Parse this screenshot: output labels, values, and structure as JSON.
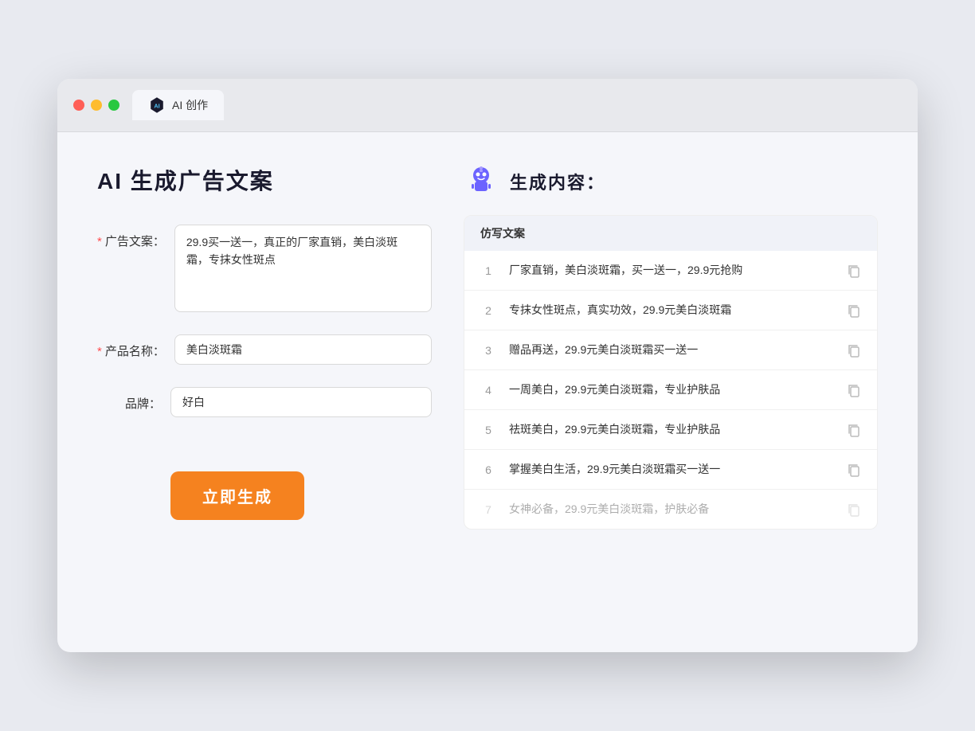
{
  "browser": {
    "tab_label": "AI 创作"
  },
  "page": {
    "title": "AI 生成广告文案",
    "results_title": "生成内容："
  },
  "form": {
    "ad_copy_label": "广告文案：",
    "ad_copy_required": "*",
    "ad_copy_value": "29.9买一送一，真正的厂家直销，美白淡斑霜，专抹女性斑点",
    "product_name_label": "产品名称：",
    "product_name_required": "*",
    "product_name_value": "美白淡斑霜",
    "brand_label": "品牌：",
    "brand_value": "好白",
    "generate_button": "立即生成"
  },
  "results": {
    "column_header": "仿写文案",
    "items": [
      {
        "id": 1,
        "text": "厂家直销，美白淡斑霜，买一送一，29.9元抢购"
      },
      {
        "id": 2,
        "text": "专抹女性斑点，真实功效，29.9元美白淡斑霜"
      },
      {
        "id": 3,
        "text": "赠品再送，29.9元美白淡斑霜买一送一"
      },
      {
        "id": 4,
        "text": "一周美白，29.9元美白淡斑霜，专业护肤品"
      },
      {
        "id": 5,
        "text": "祛斑美白，29.9元美白淡斑霜，专业护肤品"
      },
      {
        "id": 6,
        "text": "掌握美白生活，29.9元美白淡斑霜买一送一"
      },
      {
        "id": 7,
        "text": "女神必备，29.9元美白淡斑霜，护肤必备"
      }
    ]
  }
}
